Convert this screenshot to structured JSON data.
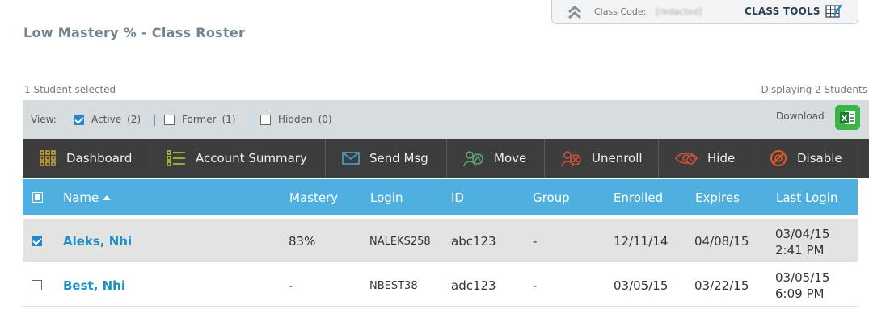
{
  "class_tools": {
    "code_label": "Class Code:",
    "code_value": "[redacted]",
    "tools_label": "CLASS TOOLS"
  },
  "page_title": "Low Mastery % - Class Roster",
  "selected_count": "1 Student selected",
  "displaying": "Displaying 2 Students",
  "view_bar": {
    "label": "View:",
    "filters": [
      {
        "label": "Active",
        "count": "(2)",
        "checked": true
      },
      {
        "label": "Former",
        "count": "(1)",
        "checked": false
      },
      {
        "label": "Hidden",
        "count": "(0)",
        "checked": false
      }
    ],
    "download_label": "Download"
  },
  "toolbar": [
    {
      "label": "Dashboard",
      "icon": "dashboard-grid-icon",
      "color": "#c8a23a"
    },
    {
      "label": "Account Summary",
      "icon": "account-list-icon",
      "color": "#b5c43a"
    },
    {
      "label": "Send Msg",
      "icon": "envelope-icon",
      "color": "#4aa3d6"
    },
    {
      "label": "Move",
      "icon": "move-icon",
      "color": "#5aa875"
    },
    {
      "label": "Unenroll",
      "icon": "unenroll-icon",
      "color": "#d0523a"
    },
    {
      "label": "Hide",
      "icon": "hide-eye-icon",
      "color": "#d0523a"
    },
    {
      "label": "Disable",
      "icon": "disable-icon",
      "color": "#e35a2a"
    }
  ],
  "table": {
    "headers": [
      "Name",
      "Mastery",
      "Login",
      "ID",
      "Group",
      "Enrolled",
      "Expires",
      "Last Login"
    ],
    "rows": [
      {
        "selected": true,
        "name": "Aleks, Nhi",
        "mastery": "83%",
        "login": "NALEKS258",
        "id": "abc123",
        "group": "-",
        "enrolled": "12/11/14",
        "expires": "04/08/15",
        "last_login_date": "03/04/15",
        "last_login_time": "2:41 PM"
      },
      {
        "selected": false,
        "name": "Best, Nhi",
        "mastery": "-",
        "login": "NBEST38",
        "id": "adc123",
        "group": "-",
        "enrolled": "03/05/15",
        "expires": "03/22/15",
        "last_login_date": "03/05/15",
        "last_login_time": "6:09 PM"
      }
    ]
  }
}
